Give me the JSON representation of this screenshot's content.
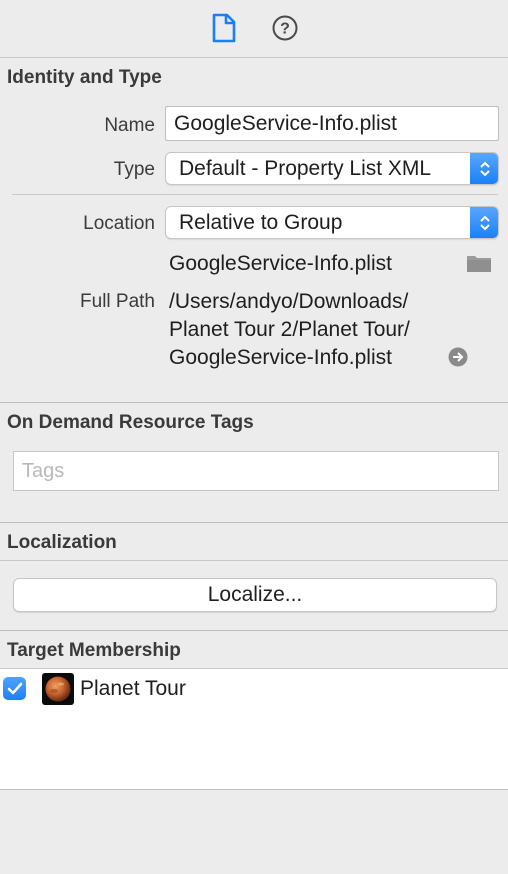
{
  "toolbar": {
    "file_inspector_icon": "file-icon",
    "quick_help_icon": "question-mark-circle-icon",
    "quick_help_glyph": "?"
  },
  "identity": {
    "section_title": "Identity and Type",
    "name_label": "Name",
    "name_value": "GoogleService-Info.plist",
    "type_label": "Type",
    "type_value": "Default - Property List XML",
    "location_label": "Location",
    "location_value": "Relative to Group",
    "filename": "GoogleService-Info.plist",
    "full_path_label": "Full Path",
    "full_path_line1": "/Users/andyo/Downloads/",
    "full_path_line2": "Planet Tour 2/Planet Tour/",
    "full_path_line3": "GoogleService-Info.plist"
  },
  "on_demand": {
    "section_title": "On Demand Resource Tags",
    "tags_placeholder": "Tags"
  },
  "localization": {
    "section_title": "Localization",
    "localize_button": "Localize..."
  },
  "target_membership": {
    "section_title": "Target Membership",
    "targets": [
      {
        "label": "Planet Tour",
        "checked": true,
        "icon": "planet-app-icon"
      }
    ]
  },
  "colors": {
    "accent": "#1a7ff5",
    "panel_bg": "#ececec"
  }
}
